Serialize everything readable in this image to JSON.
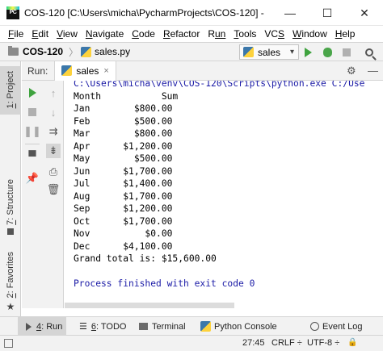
{
  "window": {
    "title": "COS-120 [C:\\Users\\micha\\PycharmProjects\\COS-120] - ...\\sale...",
    "minimize_glyph": "—",
    "maximize_glyph": "☐",
    "close_glyph": "✕"
  },
  "menu": [
    {
      "mn": "F",
      "rest": "ile"
    },
    {
      "mn": "E",
      "rest": "dit"
    },
    {
      "mn": "V",
      "rest": "iew"
    },
    {
      "mn": "N",
      "rest": "avigate"
    },
    {
      "mn": "C",
      "rest": "ode"
    },
    {
      "mn": "R",
      "rest": "efactor"
    },
    {
      "mn": "R",
      "rest": "un"
    },
    {
      "mn": "T",
      "rest": "ools"
    },
    {
      "mn": "VC",
      "rest": "S"
    },
    {
      "mn": "W",
      "rest": "indow"
    },
    {
      "mn": "H",
      "rest": "elp"
    }
  ],
  "navbar": {
    "project": "COS-120",
    "separator": "〉",
    "file": "sales.py",
    "run_config": "sales",
    "run_config_chevron": "▾"
  },
  "left_stripe": {
    "project": {
      "num": "1",
      "rest": ": Project"
    },
    "structure": {
      "num": "7",
      "rest": ": Structure"
    },
    "favorites": {
      "num": "2",
      "rest": ": Favorites"
    }
  },
  "run_panel": {
    "label": "Run:",
    "tab": "sales",
    "tab_close": "×",
    "gear_glyph": "⚙",
    "hide_glyph": "—"
  },
  "console": {
    "command": "C:\\Users\\micha\\venv\\COS-120\\Scripts\\python.exe C:/Use",
    "header_month": "Month",
    "header_sum": "Sum",
    "rows": [
      {
        "month": "Jan",
        "sum": "$800.00"
      },
      {
        "month": "Feb",
        "sum": "$500.00"
      },
      {
        "month": "Mar",
        "sum": "$800.00"
      },
      {
        "month": "Apr",
        "sum": "$1,200.00"
      },
      {
        "month": "May",
        "sum": "$500.00"
      },
      {
        "month": "Jun",
        "sum": "$1,700.00"
      },
      {
        "month": "Jul",
        "sum": "$1,400.00"
      },
      {
        "month": "Aug",
        "sum": "$1,700.00"
      },
      {
        "month": "Sep",
        "sum": "$1,200.00"
      },
      {
        "month": "Oct",
        "sum": "$1,700.00"
      },
      {
        "month": "Nov",
        "sum": "$0.00"
      },
      {
        "month": "Dec",
        "sum": "$4,100.00"
      }
    ],
    "grand_total": "Grand total is: $15,600.00",
    "finished": "Process finished with exit code 0"
  },
  "bottom_tabs": {
    "run": {
      "num": "4",
      "rest": ": Run"
    },
    "todo": {
      "num": "6",
      "rest": ": TODO"
    },
    "terminal": "Terminal",
    "python_console": "Python Console",
    "event_log": "Event Log"
  },
  "status": {
    "position": "27:45",
    "line_sep": "CRLF ÷",
    "encoding": "UTF-8 ÷",
    "lock_glyph": "🔒"
  },
  "colors": {
    "console_command": "#1a1aa6",
    "run_green": "#3fa33f",
    "chrome_bg": "#f2f2f2"
  }
}
